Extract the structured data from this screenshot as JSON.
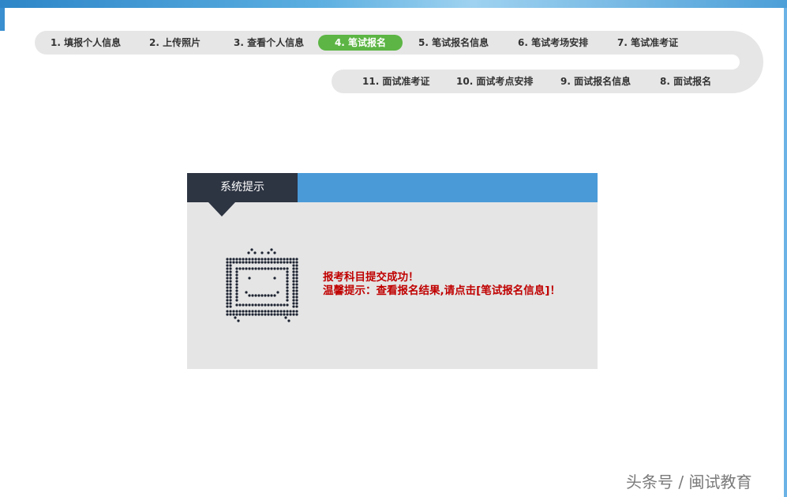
{
  "steps_row1": [
    {
      "label": "1. 填报个人信息",
      "active": false
    },
    {
      "label": "2. 上传照片",
      "active": false
    },
    {
      "label": "3. 查看个人信息",
      "active": false
    },
    {
      "label": "4. 笔试报名",
      "active": true
    },
    {
      "label": "5. 笔试报名信息",
      "active": false
    },
    {
      "label": "6. 笔试考场安排",
      "active": false
    },
    {
      "label": "7. 笔试准考证",
      "active": false
    }
  ],
  "steps_row2": [
    {
      "label": "11. 面试准考证"
    },
    {
      "label": "10. 面试考点安排"
    },
    {
      "label": "9. 面试报名信息"
    },
    {
      "label": "8. 面试报名"
    }
  ],
  "dialog": {
    "title": "系统提示",
    "line1": "报考科目提交成功！",
    "line2": "温馨提示：查看报名结果,请点击[笔试报名信息]！",
    "icon": "tv-icon"
  },
  "colors": {
    "active_step": "#5cb544",
    "header_blue": "#4a9ad8",
    "header_dark": "#2d3442",
    "message_red": "#c00000"
  },
  "watermark": "头条号 / 闽试教育"
}
